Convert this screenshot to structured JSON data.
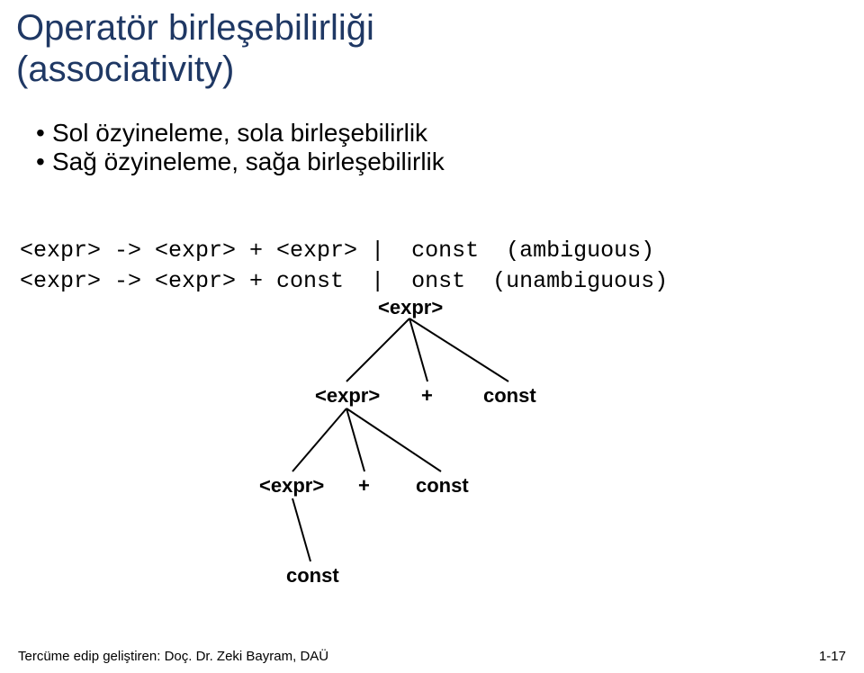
{
  "title": {
    "line1": "Operatör birleşebilirliği",
    "line2": "(associativity)"
  },
  "bullets": {
    "b1": "Sol özyineleme, sola birleşebilirlik",
    "b2": "Sağ özyineleme, sağa birleşebilirlik"
  },
  "grammar": {
    "line1": "<expr> -> <expr> + <expr> |  const  (ambiguous)",
    "line2_a": "<expr> -> <expr> + const  |  ",
    "line2_b": "onst  (unambiguous)"
  },
  "tree": {
    "n_root": "<expr>",
    "n_l1_expr": "<expr>",
    "n_l1_plus": "+",
    "n_l1_const": "const",
    "n_l2_expr": "<expr>",
    "n_l2_plus": "+",
    "n_l2_const": "const",
    "n_l3_const": "const"
  },
  "footer": "Tercüme edip geliştiren: Doç. Dr. Zeki Bayram, DAÜ",
  "pagenum": "1-17"
}
